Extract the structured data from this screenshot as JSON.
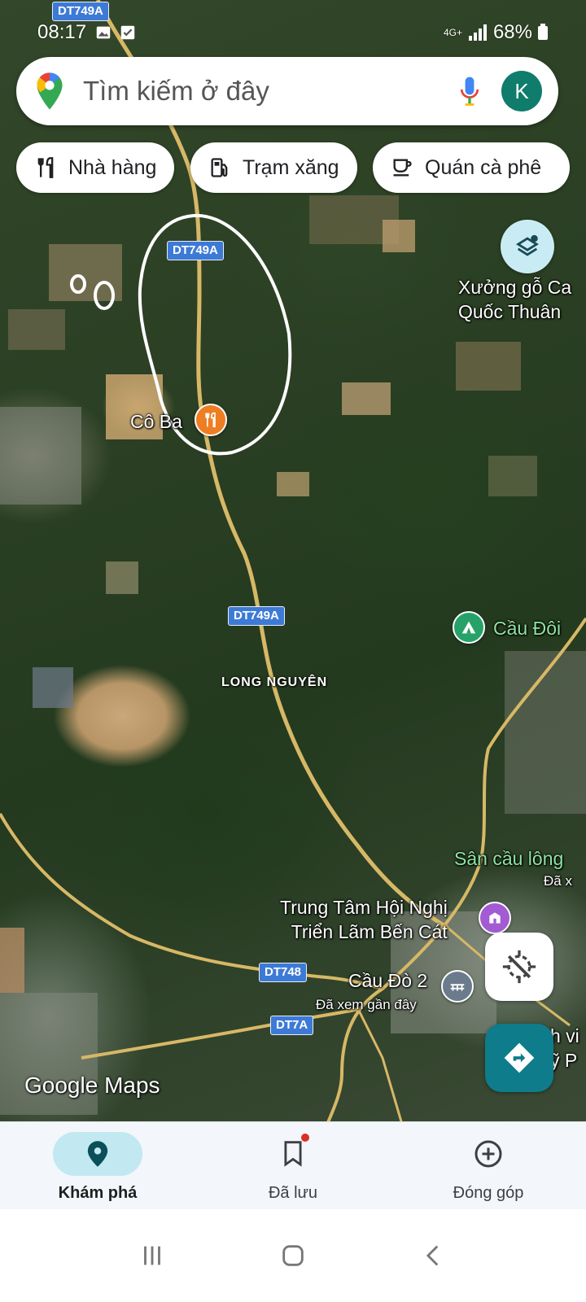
{
  "status_bar": {
    "time": "08:17",
    "network": "4G+",
    "battery": "68%",
    "left_icons": [
      "image-icon",
      "check-box-icon"
    ]
  },
  "search": {
    "placeholder": "Tìm kiếm ở đây",
    "avatar_letter": "K",
    "avatar_color": "#0f7c6c"
  },
  "chips": [
    {
      "label": "Nhà hàng",
      "icon": "restaurant-icon"
    },
    {
      "label": "Trạm xăng",
      "icon": "gas-station-icon"
    },
    {
      "label": "Quán cà phê",
      "icon": "coffee-icon"
    }
  ],
  "map": {
    "road_shields": [
      "DT749A",
      "DT749A",
      "DT749A",
      "DT748",
      "DT7A"
    ],
    "area_label": "LONG NGUYÊN",
    "places": [
      {
        "name": "Cô Ba",
        "type": "restaurant"
      },
      {
        "name": "Xưởng gỗ Ca\nQuốc Thuân"
      },
      {
        "name": "Cầu Đôi",
        "type": "park"
      },
      {
        "name": "Sân cầu lông"
      },
      {
        "name": "Đã x"
      },
      {
        "name": "Trung Tâm Hội Nghị\nTriển Lãm Bến Cát",
        "type": "venue"
      },
      {
        "name": "Cầu Đò 2",
        "type": "bridge"
      },
      {
        "name": "Đã xem gần đây"
      },
      {
        "name": "h vi\nỹ P"
      }
    ],
    "watermark": "Google Maps"
  },
  "colors": {
    "road": "#d7b866",
    "shield": "#3d7ad6",
    "accent_teal": "#0e7c8a",
    "restaurant_pin": "#ef7d22",
    "park_pin": "#26a269",
    "venue_pin": "#a35bd3",
    "bridge_pin": "#6b7b8c"
  },
  "bottom_nav": [
    {
      "label": "Khám phá",
      "icon": "location-pin-icon",
      "active": true
    },
    {
      "label": "Đã lưu",
      "icon": "bookmark-icon",
      "active": false,
      "badge": true
    },
    {
      "label": "Đóng góp",
      "icon": "add-circle-icon",
      "active": false
    }
  ],
  "system_nav": [
    "recents-icon",
    "home-icon",
    "back-icon"
  ]
}
